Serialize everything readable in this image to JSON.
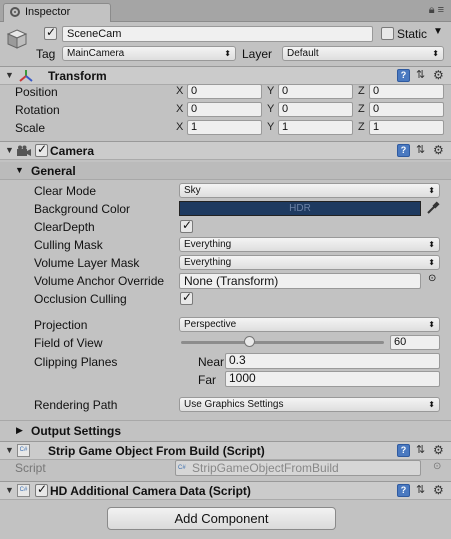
{
  "tab": {
    "label": "Inspector"
  },
  "header": {
    "object_name": "SceneCam",
    "static_label": "Static",
    "tag_label": "Tag",
    "tag_value": "MainCamera",
    "layer_label": "Layer",
    "layer_value": "Default"
  },
  "transform": {
    "title": "Transform",
    "rows": [
      {
        "label": "Position",
        "x": "0",
        "y": "0",
        "z": "0"
      },
      {
        "label": "Rotation",
        "x": "0",
        "y": "0",
        "z": "0"
      },
      {
        "label": "Scale",
        "x": "1",
        "y": "1",
        "z": "1"
      }
    ],
    "axis": {
      "x": "X",
      "y": "Y",
      "z": "Z"
    }
  },
  "camera": {
    "title": "Camera",
    "general_title": "General",
    "clear_mode_label": "Clear Mode",
    "clear_mode_value": "Sky",
    "background_color_label": "Background Color",
    "background_color_text": "HDR",
    "background_color": "#1e3a60",
    "clear_depth_label": "ClearDepth",
    "culling_mask_label": "Culling Mask",
    "culling_mask_value": "Everything",
    "volume_layer_mask_label": "Volume Layer Mask",
    "volume_layer_mask_value": "Everything",
    "volume_anchor_label": "Volume Anchor Override",
    "volume_anchor_value": "None (Transform)",
    "occlusion_label": "Occlusion Culling",
    "projection_label": "Projection",
    "projection_value": "Perspective",
    "fov_label": "Field of View",
    "fov_value": "60",
    "fov_fraction": 0.33,
    "clipping_label": "Clipping Planes",
    "near_label": "Near",
    "near_value": "0.3",
    "far_label": "Far",
    "far_value": "1000",
    "rendering_path_label": "Rendering Path",
    "rendering_path_value": "Use Graphics Settings",
    "output_settings_title": "Output Settings"
  },
  "strip": {
    "title": "Strip Game Object From Build (Script)",
    "script_label": "Script",
    "script_value": "StripGameObjectFromBuild"
  },
  "hd": {
    "title": "HD Additional Camera Data (Script)"
  },
  "add_component_label": "Add Component"
}
